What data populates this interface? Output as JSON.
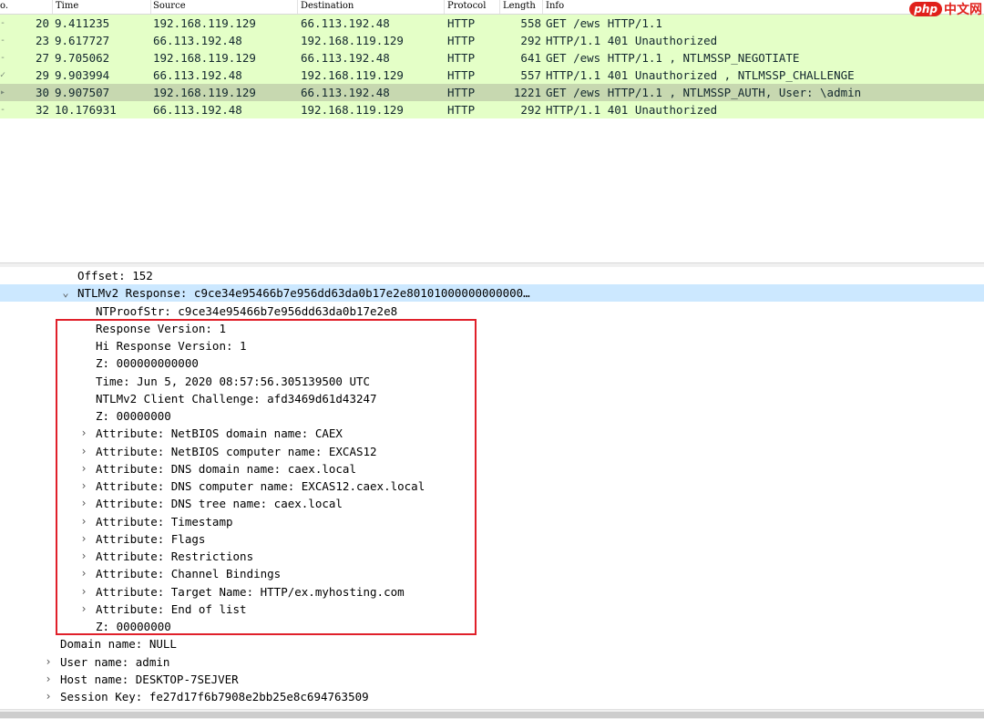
{
  "packet_list": {
    "columns": {
      "no": "o.",
      "time": "Time",
      "source": "Source",
      "destination": "Destination",
      "protocol": "Protocol",
      "length": "Length",
      "info": "Info"
    },
    "rows": [
      {
        "marker": "-",
        "no": "20",
        "time": "9.411235",
        "source": "192.168.119.129",
        "destination": "66.113.192.48",
        "protocol": "HTTP",
        "length": "558",
        "info": "GET /ews HTTP/1.1"
      },
      {
        "marker": "-",
        "no": "23",
        "time": "9.617727",
        "source": "66.113.192.48",
        "destination": "192.168.119.129",
        "protocol": "HTTP",
        "length": "292",
        "info": "HTTP/1.1 401 Unauthorized"
      },
      {
        "marker": "-",
        "no": "27",
        "time": "9.705062",
        "source": "192.168.119.129",
        "destination": "66.113.192.48",
        "protocol": "HTTP",
        "length": "641",
        "info": "GET /ews HTTP/1.1 , NTLMSSP_NEGOTIATE"
      },
      {
        "marker": "✓",
        "no": "29",
        "time": "9.903994",
        "source": "66.113.192.48",
        "destination": "192.168.119.129",
        "protocol": "HTTP",
        "length": "557",
        "info": "HTTP/1.1 401 Unauthorized , NTLMSSP_CHALLENGE"
      },
      {
        "marker": "▸",
        "no": "30",
        "time": "9.907507",
        "source": "192.168.119.129",
        "destination": "66.113.192.48",
        "protocol": "HTTP",
        "length": "1221",
        "info": "GET /ews HTTP/1.1 , NTLMSSP_AUTH, User: \\admin"
      },
      {
        "marker": "-",
        "no": "32",
        "time": "10.176931",
        "source": "66.113.192.48",
        "destination": "192.168.119.129",
        "protocol": "HTTP",
        "length": "292",
        "info": "HTTP/1.1 401 Unauthorized"
      }
    ],
    "selected_index": 4,
    "row_color": "#e4ffc7",
    "selected_row_color": "#c7d8b0"
  },
  "watermark": {
    "logo": "php",
    "site": "中文网"
  },
  "details": {
    "rows": [
      {
        "arrow": "",
        "text": "Offset: 152"
      },
      {
        "arrow": "⌄",
        "text": "NTLMv2 Response: c9ce34e95466b7e956dd63da0b17e2e80101000000000000…"
      },
      {
        "arrow": "",
        "text": "NTProofStr: c9ce34e95466b7e956dd63da0b17e2e8"
      },
      {
        "arrow": "",
        "text": "Response Version: 1"
      },
      {
        "arrow": "",
        "text": "Hi Response Version: 1"
      },
      {
        "arrow": "",
        "text": "Z: 000000000000"
      },
      {
        "arrow": "",
        "text": "Time: Jun  5, 2020 08:57:56.305139500 UTC"
      },
      {
        "arrow": "",
        "text": "NTLMv2 Client Challenge: afd3469d61d43247"
      },
      {
        "arrow": "",
        "text": "Z: 00000000"
      },
      {
        "arrow": "›",
        "text": "Attribute: NetBIOS domain name: CAEX"
      },
      {
        "arrow": "›",
        "text": "Attribute: NetBIOS computer name: EXCAS12"
      },
      {
        "arrow": "›",
        "text": "Attribute: DNS domain name: caex.local"
      },
      {
        "arrow": "›",
        "text": "Attribute: DNS computer name: EXCAS12.caex.local"
      },
      {
        "arrow": "›",
        "text": "Attribute: DNS tree name: caex.local"
      },
      {
        "arrow": "›",
        "text": "Attribute: Timestamp"
      },
      {
        "arrow": "›",
        "text": "Attribute: Flags"
      },
      {
        "arrow": "›",
        "text": "Attribute: Restrictions"
      },
      {
        "arrow": "›",
        "text": "Attribute: Channel Bindings"
      },
      {
        "arrow": "›",
        "text": "Attribute: Target Name: HTTP/ex.myhosting.com"
      },
      {
        "arrow": "›",
        "text": "Attribute: End of list"
      },
      {
        "arrow": "",
        "text": "Z: 00000000"
      },
      {
        "arrow": "",
        "text": "Domain name: NULL"
      },
      {
        "arrow": "›",
        "text": "User name: admin"
      },
      {
        "arrow": "›",
        "text": "Host name: DESKTOP-7SEJVER"
      },
      {
        "arrow": "›",
        "text": "Session Key: fe27d17f6b7908e2bb25e8c694763509"
      }
    ],
    "selected_index": 1,
    "selected_color": "#cce8ff",
    "highlight_color": "#e0202a"
  }
}
